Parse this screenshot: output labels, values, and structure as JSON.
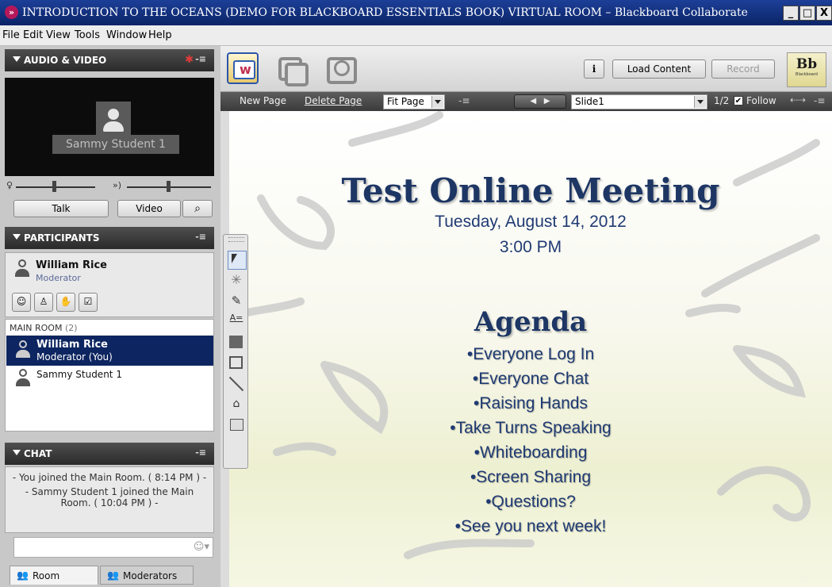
{
  "window": {
    "title": "INTRODUCTION TO THE OCEANS (DEMO FOR BLACKBOARD ESSENTIALS BOOK) VIRTUAL ROOM – Blackboard Collaborate",
    "minimize": "_",
    "maximize": "□",
    "close": "X"
  },
  "menu": [
    "File",
    "Edit",
    "View",
    "Tools",
    "Window",
    "Help"
  ],
  "audio_video": {
    "header": "AUDIO & VIDEO",
    "participant_name": "Sammy Student 1",
    "talk_label": "Talk",
    "video_label": "Video"
  },
  "participants": {
    "header": "PARTICIPANTS",
    "self_name": "William Rice",
    "self_role": "Moderator",
    "room_label": "MAIN ROOM",
    "room_count": "(2)",
    "list": [
      {
        "name": "William Rice",
        "role": "Moderator (You)"
      },
      {
        "name": "Sammy Student 1",
        "role": ""
      }
    ]
  },
  "chat": {
    "header": "CHAT",
    "messages": [
      "- You joined the Main Room. ( 8:14 PM ) -",
      "- Sammy Student 1 joined the Main Room. ( 10:04 PM ) -"
    ],
    "input_value": "",
    "tabs": [
      "Room",
      "Moderators"
    ]
  },
  "toolbar": {
    "info_label": "i",
    "load_content": "Load Content",
    "record": "Record",
    "bb_logo": "Bb",
    "bb_sub": "Blackboard",
    "new_page": "New Page",
    "delete_page": "Delete Page",
    "fit_page": "Fit Page",
    "slide_select": "Slide1",
    "page_counter": "1/2",
    "follow_label": "Follow",
    "menu_glyph": "-≡"
  },
  "slide": {
    "title": "Test Online Meeting",
    "date": "Tuesday, August 14, 2012",
    "time": "3:00 PM",
    "agenda_title": "Agenda",
    "agenda": [
      "•Everyone Log In",
      "•Everyone Chat",
      "•Raising Hands",
      "•Take Turns Speaking",
      "•Whiteboarding",
      "•Screen Sharing",
      "•Questions?",
      "•See you next week!"
    ]
  },
  "colors": {
    "title_bar": "#0b2466",
    "slide_text": "#1d3664",
    "selected_row": "#0d2560"
  }
}
